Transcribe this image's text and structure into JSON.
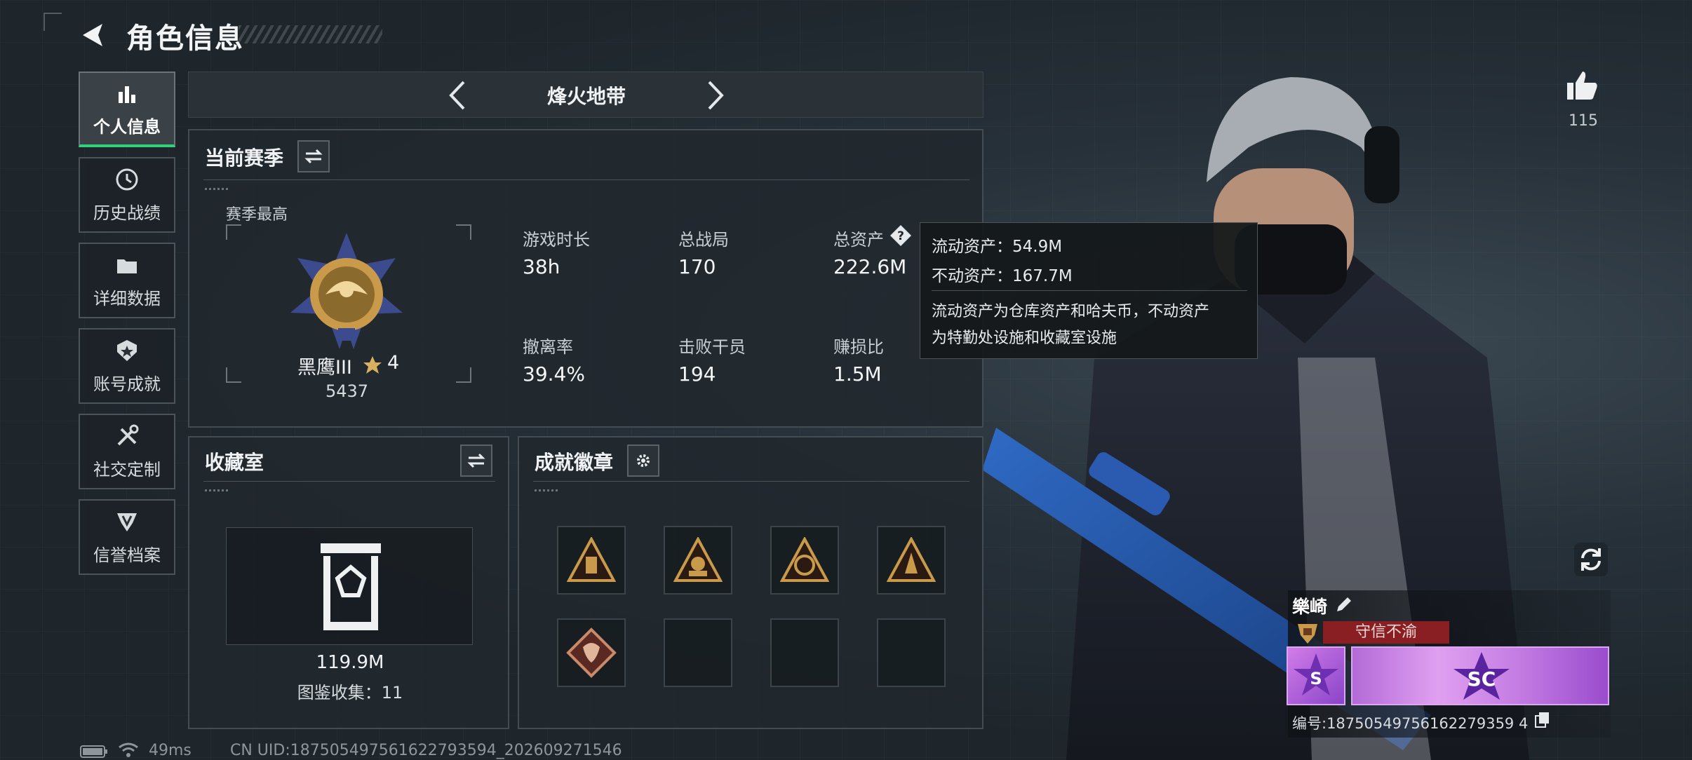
{
  "header": {
    "title": "角色信息"
  },
  "sidebar": {
    "items": [
      {
        "label": "个人信息",
        "icon": "bar-chart-icon",
        "active": true
      },
      {
        "label": "历史战绩",
        "icon": "clock-icon",
        "active": false
      },
      {
        "label": "详细数据",
        "icon": "folder-icon",
        "active": false
      },
      {
        "label": "账号成就",
        "icon": "shield-star-icon",
        "active": false
      },
      {
        "label": "社交定制",
        "icon": "tools-icon",
        "active": false
      },
      {
        "label": "信誉档案",
        "icon": "crest-icon",
        "active": false
      }
    ]
  },
  "season_selector": {
    "name": "烽火地带"
  },
  "current_season": {
    "title": "当前赛季",
    "best_label": "赛季最高",
    "rank_name": "黑鹰III",
    "rank_stars": "4",
    "rank_score": "5437",
    "stats": [
      {
        "label": "游戏时长",
        "value": "38h"
      },
      {
        "label": "总战局",
        "value": "170"
      },
      {
        "label": "总资产",
        "value": "222.6M"
      },
      {
        "label": "撤离率",
        "value": "39.4%"
      },
      {
        "label": "击败干员",
        "value": "194"
      },
      {
        "label": "赚损比",
        "value": "1.5M"
      }
    ]
  },
  "asset_tooltip": {
    "liquid": "流动资产：54.9M",
    "fixed": "不动资产：167.7M",
    "note_line1": "流动资产为仓库资产和哈夫币，不动资产",
    "note_line2": "为特勤处设施和收藏室设施"
  },
  "collection": {
    "title": "收藏室",
    "value": "119.9M",
    "collected": "图鉴收集：11"
  },
  "achievements": {
    "title": "成就徽章",
    "slots": [
      {
        "filled": true,
        "icon": "triangle-badge-icon"
      },
      {
        "filled": true,
        "icon": "triangle-badge-icon"
      },
      {
        "filled": true,
        "icon": "triangle-badge-icon"
      },
      {
        "filled": true,
        "icon": "triangle-badge-icon"
      },
      {
        "filled": true,
        "icon": "diamond-dragon-badge-icon"
      },
      {
        "filled": false
      },
      {
        "filled": false
      },
      {
        "filled": false
      }
    ]
  },
  "likes": {
    "count": "115"
  },
  "player": {
    "name": "樂崎",
    "reputation": "守信不渝",
    "id_label": "编号:18750549756162279359 4"
  },
  "footer": {
    "ping": "49ms",
    "uid": "CN UID:187505497561622793594_202609271546"
  },
  "colors": {
    "accent_green": "#2fd17b",
    "panel_bg": "#21282d",
    "reputation_red": "#8a1f23",
    "badge_gold": "#c99a4a"
  }
}
